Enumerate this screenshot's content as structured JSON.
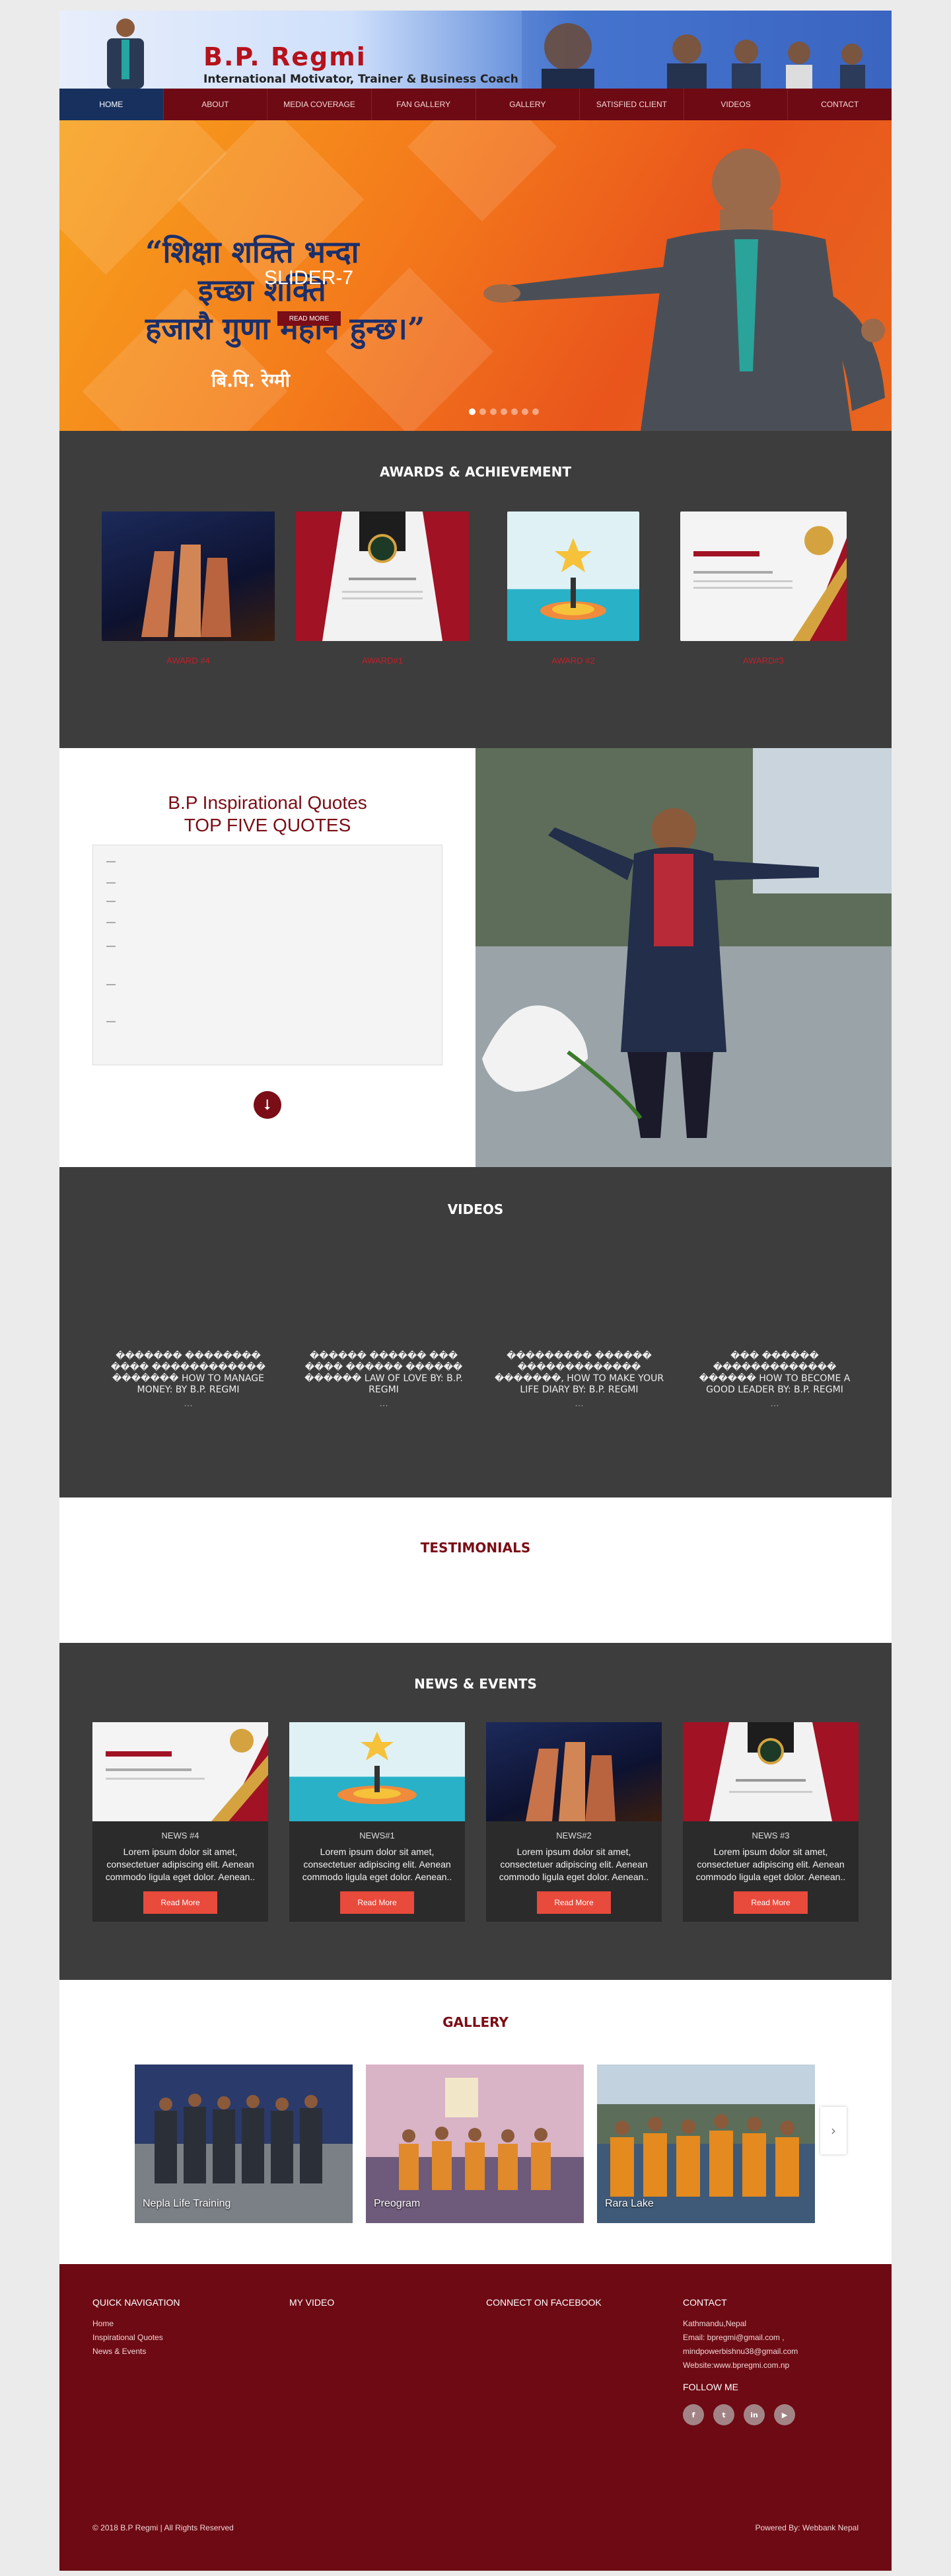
{
  "header": {
    "brand_name": "B.P. Regmi",
    "tagline": "International Motivator, Trainer & Business Coach"
  },
  "nav": [
    "HOME",
    "ABOUT",
    "MEDIA COVERAGE",
    "FAN GALLERY",
    "GALLERY",
    "SATISFIED CLIENT",
    "VIDEOS",
    "CONTACT"
  ],
  "slider": {
    "quote_line1": "“शिक्षा शक्ति भन्दा",
    "quote_line2": "इच्छा शक्ति",
    "quote_line3": "हजारौ गुणा महान हुन्छ।”",
    "author": "बि.पि. रेग्मी",
    "title": "SLIDER-7",
    "read_more": "READ MORE",
    "active_dot": 0,
    "dot_count": 7
  },
  "awards": {
    "title": "AWARDS & ACHIEVEMENT",
    "items": [
      {
        "label": "AWARD #4"
      },
      {
        "label": "AWARD#1"
      },
      {
        "label": "AWARD #2"
      },
      {
        "label": "AWARD#3"
      }
    ]
  },
  "quotes": {
    "title_line1": "B.P Inspirational Quotes",
    "title_line2": "TOP FIVE QUOTES"
  },
  "videos": {
    "title": "VIDEOS",
    "items": [
      {
        "title": "������� �������� ���� ������������ ������� HOW TO MANAGE MONEY: BY B.P. REGMI",
        "ellipsis": "..."
      },
      {
        "title": "������ ������ ��� ���� ������ ������ ������ LAW OF LOVE BY: B.P. REGMI",
        "ellipsis": "..."
      },
      {
        "title": "��������� ������ ������������� �������, HOW TO MAKE YOUR LIFE DIARY BY: B.P. REGMI",
        "ellipsis": "..."
      },
      {
        "title": "��� ������ ������������� ������ HOW TO BECOME A GOOD LEADER BY: B.P. REGMI",
        "ellipsis": "..."
      }
    ]
  },
  "testimonials": {
    "title": "TESTIMONIALS"
  },
  "news": {
    "title": "NEWS & EVENTS",
    "items": [
      {
        "title": "NEWS #4",
        "body": "Lorem ipsum dolor sit amet, consectetuer adipiscing elit. Aenean commodo ligula eget dolor. Aenean..",
        "button": "Read More"
      },
      {
        "title": "NEWS#1",
        "body": "Lorem ipsum dolor sit amet, consectetuer adipiscing elit. Aenean commodo ligula eget dolor. Aenean..",
        "button": "Read More"
      },
      {
        "title": "NEWS#2",
        "body": "Lorem ipsum dolor sit amet, consectetuer adipiscing elit. Aenean commodo ligula eget dolor. Aenean..",
        "button": "Read More"
      },
      {
        "title": "NEWS #3",
        "body": "Lorem ipsum dolor sit amet, consectetuer adipiscing elit. Aenean commodo ligula eget dolor. Aenean..",
        "button": "Read More"
      }
    ]
  },
  "gallery": {
    "title": "GALLERY",
    "items": [
      {
        "caption": "Nepla Life Training"
      },
      {
        "caption": "Preogram"
      },
      {
        "caption": "Rara Lake"
      }
    ],
    "next_icon": "chevron-right-icon"
  },
  "footer": {
    "quick_nav_title": "QUICK NAVIGATION",
    "quick_nav": [
      "Home",
      "Inspirational Quotes",
      "News & Events"
    ],
    "video_title": "MY VIDEO",
    "facebook_title": "CONNECT ON FACEBOOK",
    "contact_title": "CONTACT",
    "contact": [
      "Kathmandu,Nepal",
      "Email: bpregmi@gmail.com ,",
      "mindpowerbishnu38@gmail.com",
      "Website:www.bpregmi.com.np"
    ],
    "follow": "FOLLOW ME",
    "socials": [
      {
        "icon": "facebook-icon",
        "glyph": "f"
      },
      {
        "icon": "twitter-icon",
        "glyph": "t"
      },
      {
        "icon": "linkedin-icon",
        "glyph": "in"
      },
      {
        "icon": "youtube-icon",
        "glyph": "▶"
      }
    ],
    "copyright": "© 2018 B.P Regmi | All Rights Reserved",
    "powered": "Powered By: Webbank Nepal"
  },
  "colors": {
    "maroon": "#6d0a13",
    "navy_active": "#17305e",
    "dark_section": "#3d3d3d",
    "button_red": "#e84a3c"
  }
}
